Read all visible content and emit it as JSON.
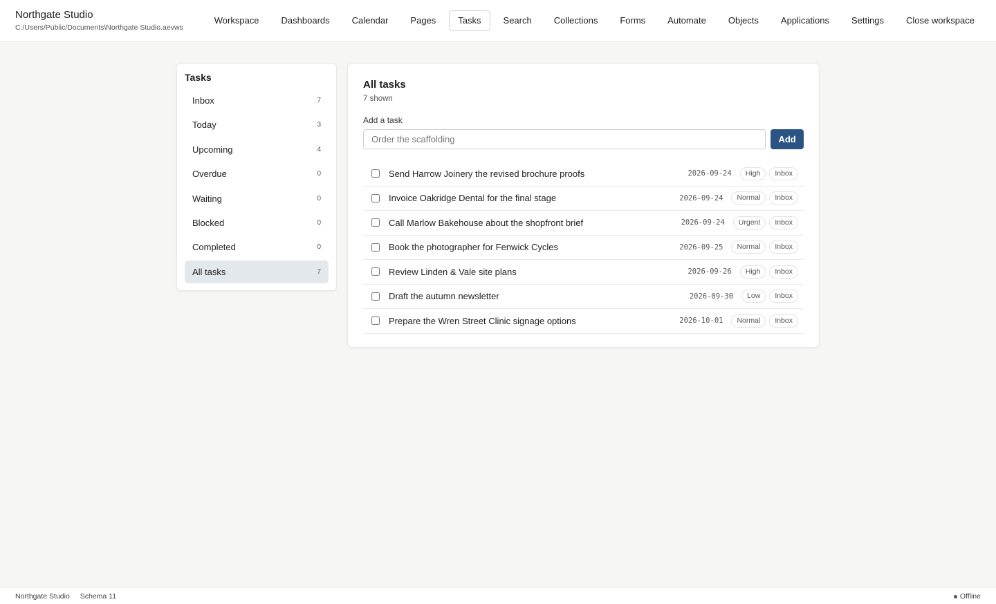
{
  "app": {
    "title": "Northgate Studio",
    "path": "C:/Users/Public/Documents\\Northgate Studio.aevws"
  },
  "nav": {
    "items": [
      {
        "label": "Workspace"
      },
      {
        "label": "Dashboards"
      },
      {
        "label": "Calendar"
      },
      {
        "label": "Pages"
      },
      {
        "label": "Tasks",
        "active": true
      },
      {
        "label": "Search"
      },
      {
        "label": "Collections"
      },
      {
        "label": "Forms"
      },
      {
        "label": "Automate"
      },
      {
        "label": "Objects"
      },
      {
        "label": "Applications"
      },
      {
        "label": "Settings"
      },
      {
        "label": "Close workspace"
      }
    ]
  },
  "sidebar": {
    "title": "Tasks",
    "items": [
      {
        "label": "Inbox",
        "count": "7"
      },
      {
        "label": "Today",
        "count": "3"
      },
      {
        "label": "Upcoming",
        "count": "4"
      },
      {
        "label": "Overdue",
        "count": "0"
      },
      {
        "label": "Waiting",
        "count": "0"
      },
      {
        "label": "Blocked",
        "count": "0"
      },
      {
        "label": "Completed",
        "count": "0"
      },
      {
        "label": "All tasks",
        "count": "7",
        "active": true
      }
    ]
  },
  "main": {
    "title": "All tasks",
    "subtitle": "7 shown",
    "add_label": "Add a task",
    "add_placeholder": "Order the scaffolding",
    "add_button": "Add",
    "tasks": [
      {
        "text": "Send Harrow Joinery the revised brochure proofs",
        "date": "2026-09-24",
        "priority": "High",
        "list": "Inbox"
      },
      {
        "text": "Invoice Oakridge Dental for the final stage",
        "date": "2026-09-24",
        "priority": "Normal",
        "list": "Inbox"
      },
      {
        "text": "Call Marlow Bakehouse about the shopfront brief",
        "date": "2026-09-24",
        "priority": "Urgent",
        "list": "Inbox"
      },
      {
        "text": "Book the photographer for Fenwick Cycles",
        "date": "2026-09-25",
        "priority": "Normal",
        "list": "Inbox"
      },
      {
        "text": "Review Linden & Vale site plans",
        "date": "2026-09-26",
        "priority": "High",
        "list": "Inbox"
      },
      {
        "text": "Draft the autumn newsletter",
        "date": "2026-09-30",
        "priority": "Low",
        "list": "Inbox"
      },
      {
        "text": "Prepare the Wren Street Clinic signage options",
        "date": "2026-10-01",
        "priority": "Normal",
        "list": "Inbox"
      }
    ]
  },
  "footer": {
    "app_name": "Northgate Studio",
    "schema": "Schema 11",
    "status": "Offline"
  }
}
